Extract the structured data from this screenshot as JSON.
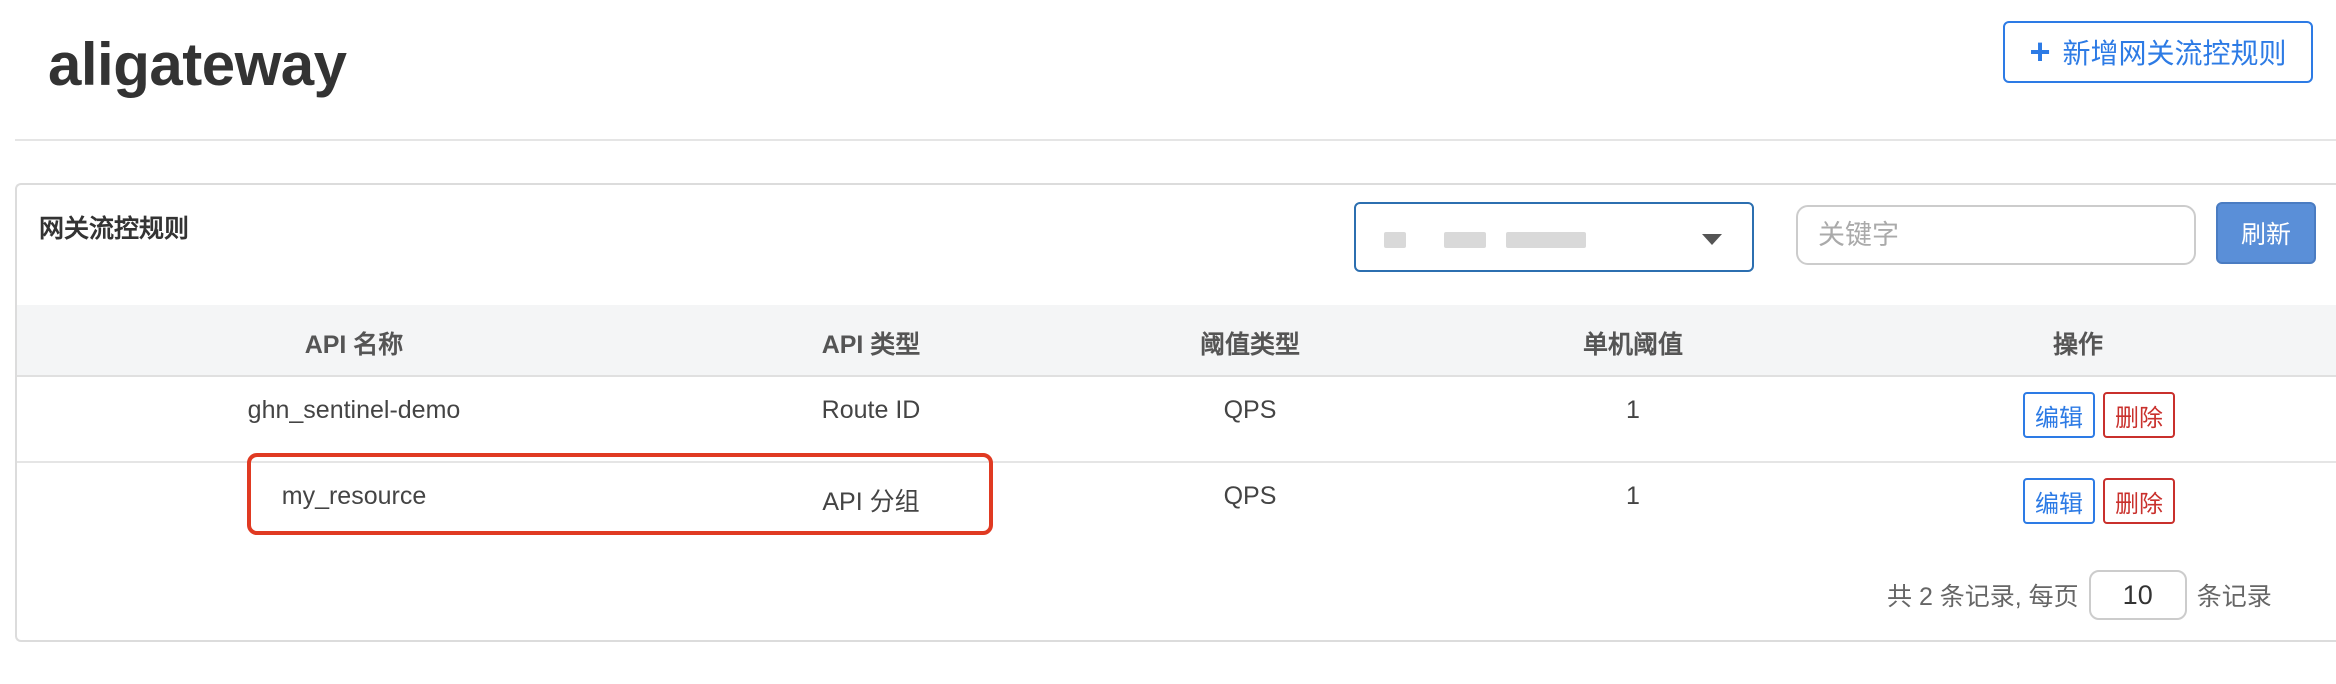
{
  "header": {
    "app_title": "aligateway",
    "add_button_label": "新增网关流控规则",
    "add_button_icon": "plus-icon"
  },
  "panel": {
    "title": "网关流控规则",
    "machine_select": {
      "value": "",
      "redacted": true,
      "icon": "caret-down-icon"
    },
    "search": {
      "placeholder": "关键字",
      "value": ""
    },
    "refresh_label": "刷新"
  },
  "table": {
    "columns": [
      "API 名称",
      "API 类型",
      "阈值类型",
      "单机阈值",
      "操作"
    ],
    "rows": [
      {
        "api_name": "ghn_sentinel-demo",
        "api_type": "Route ID",
        "threshold_type": "QPS",
        "threshold": "1",
        "edit_label": "编辑",
        "delete_label": "删除"
      },
      {
        "api_name": "my_resource",
        "api_type": "API 分组",
        "threshold_type": "QPS",
        "threshold": "1",
        "edit_label": "编辑",
        "delete_label": "删除"
      }
    ]
  },
  "pagination": {
    "summary": "共 2 条记录, 每页",
    "page_size": "10",
    "suffix": "条记录"
  },
  "colors": {
    "accent": "#2d7be5",
    "danger": "#c9302c",
    "highlight": "#e03a22",
    "refresh_bg": "#5a8fd8"
  }
}
